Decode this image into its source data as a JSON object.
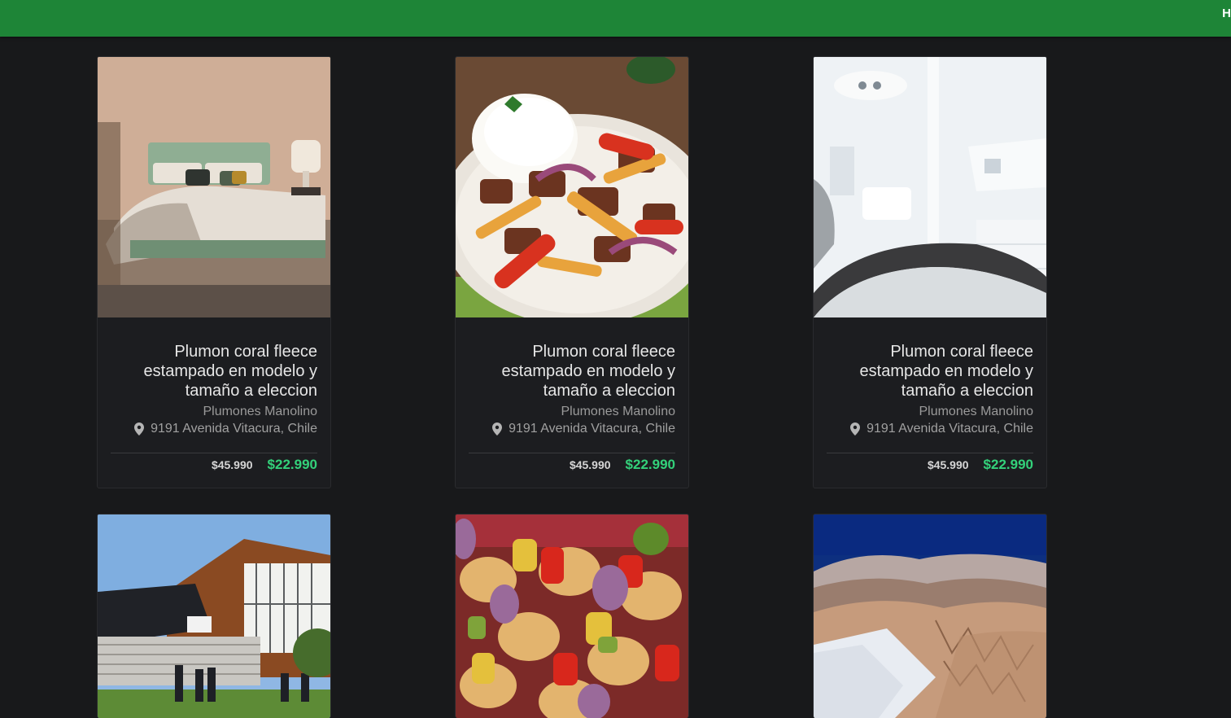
{
  "header": {
    "corner_letter": "H",
    "accent_color": "#1e8537"
  },
  "cards": [
    {
      "image_subject": "bedroom",
      "title": "Plumon coral fleece estampado en modelo y tamaño a eleccion",
      "merchant": "Plumones Manolino",
      "location": "9191 Avenida Vitacura, Chile",
      "price_original": "$45.990",
      "price_discount": "$22.990"
    },
    {
      "image_subject": "food-plate",
      "title": "Plumon coral fleece estampado en modelo y tamaño a eleccion",
      "merchant": "Plumones Manolino",
      "location": "9191 Avenida Vitacura, Chile",
      "price_original": "$45.990",
      "price_discount": "$22.990"
    },
    {
      "image_subject": "dental-chair",
      "title": "Plumon coral fleece estampado en modelo y tamaño a eleccion",
      "merchant": "Plumones Manolino",
      "location": "9191 Avenida Vitacura, Chile",
      "price_original": "$45.990",
      "price_discount": "$22.990"
    },
    {
      "image_subject": "building-event"
    },
    {
      "image_subject": "kebab-skewers"
    },
    {
      "image_subject": "desert-mountains"
    }
  ],
  "colors": {
    "background": "#18191b",
    "discount_price": "#33d17a"
  }
}
